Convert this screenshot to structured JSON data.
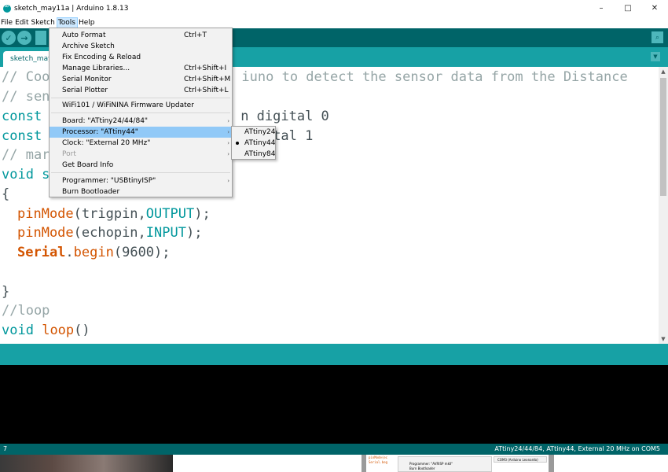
{
  "window": {
    "title": "sketch_may11a | Arduino 1.8.13",
    "minimize": "–",
    "maximize": "□",
    "close": "✕"
  },
  "menubar": {
    "items": [
      "File",
      "Edit",
      "Sketch",
      "Tools",
      "Help"
    ],
    "active": "Tools"
  },
  "toolbar": {
    "verify": "✓",
    "upload": "→",
    "serial_monitor": "⌕"
  },
  "tabs": {
    "current": "sketch_may11a",
    "dropdown": "▼"
  },
  "code": {
    "line1_a": "// Coo",
    "line1_b": "iuno to detect the sensor data from the Distance",
    "line2_a": "// sen",
    "line3_a": "const",
    "line3_b": "n digital 0",
    "line4_a": "const",
    "line4_b": "tal 1",
    "line5_a": "// mar",
    "line6_a": "void s",
    "line7": "{",
    "line8_fn": "pinMode",
    "line8_args": "(trigpin,",
    "line8_const": "OUTPUT",
    "line8_end": ");",
    "line9_fn": "pinMode",
    "line9_args": "(echopin,",
    "line9_const": "INPUT",
    "line9_end": ");",
    "line10_obj": "Serial",
    "line10_dot": ".",
    "line10_fn": "begin",
    "line10_args": "(9600);",
    "line12": "}",
    "line13": "//loop",
    "line14_kw": "void",
    "line14_fn": "loop",
    "line14_end": "()"
  },
  "tools_menu": {
    "auto_format": {
      "label": "Auto Format",
      "shortcut": "Ctrl+T"
    },
    "archive_sketch": {
      "label": "Archive Sketch"
    },
    "fix_encoding": {
      "label": "Fix Encoding & Reload"
    },
    "manage_libraries": {
      "label": "Manage Libraries...",
      "shortcut": "Ctrl+Shift+I"
    },
    "serial_monitor": {
      "label": "Serial Monitor",
      "shortcut": "Ctrl+Shift+M"
    },
    "serial_plotter": {
      "label": "Serial Plotter",
      "shortcut": "Ctrl+Shift+L"
    },
    "wifi_updater": {
      "label": "WiFi101 / WiFiNINA Firmware Updater"
    },
    "board": {
      "label": "Board: \"ATtiny24/44/84\""
    },
    "processor": {
      "label": "Processor: \"ATtiny44\""
    },
    "clock": {
      "label": "Clock: \"External 20 MHz\""
    },
    "port": {
      "label": "Port"
    },
    "board_info": {
      "label": "Get Board Info"
    },
    "programmer": {
      "label": "Programmer: \"USBtinyISP\""
    },
    "burn_bootloader": {
      "label": "Burn Bootloader"
    },
    "arrow": "›"
  },
  "processor_submenu": {
    "items": [
      "ATtiny24",
      "ATtiny44",
      "ATtiny84"
    ],
    "selected": "ATtiny44"
  },
  "status": {
    "line_number": "7",
    "board_info": "ATtiny24/44/84, ATtiny44, External 20 MHz on COM5"
  },
  "thumbnail": {
    "code1": "pinMode(ec",
    "code2": "Serial.beg",
    "menu1": "Programmer: \"AVRISP mkII\"",
    "menu2": "Burn Bootloader",
    "sub": "COM3 (Arduino Leonardo)"
  },
  "scrollbar": {
    "up": "▲",
    "down": "▼"
  }
}
